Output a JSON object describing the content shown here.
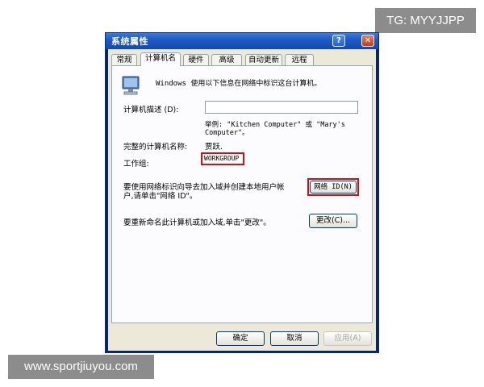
{
  "watermarks": {
    "top": "TG: MYYJJPP",
    "bottom": "www.sportjiuyou.com"
  },
  "dialog": {
    "title": "系统属性",
    "help_button": "?",
    "close_button": "✕",
    "tabs": [
      {
        "label": "常规",
        "active": false
      },
      {
        "label": "计算机名",
        "active": true
      },
      {
        "label": "硬件",
        "active": false
      },
      {
        "label": "高级",
        "active": false
      },
      {
        "label": "自动更新",
        "active": false
      },
      {
        "label": "远程",
        "active": false
      }
    ],
    "intro": "Windows 使用以下信息在网络中标识这台计算机。",
    "description_label": "计算机描述 (D):",
    "description_value": "",
    "example_line1": "举例: \"Kitchen Computer\" 或 \"Mary's",
    "example_line2": "Computer\"。",
    "fullname_label": "完整的计算机名称:",
    "fullname_value": "贾跃.",
    "workgroup_label": "工作组:",
    "workgroup_value": "WORKGROUP",
    "network_text_line1": "要使用网络标识向导去加入域并创建本地用户帐",
    "network_text_line2": "户,请单击\"网络 ID\"。",
    "network_id_button": "网络 ID(N)",
    "rename_text": "要重新命名此计算机或加入域,单击\"更改\"。",
    "change_button": "更改(C)...",
    "ok_button": "确定",
    "cancel_button": "取消",
    "apply_button": "应用(A)",
    "accent_color": "#cc1111"
  }
}
